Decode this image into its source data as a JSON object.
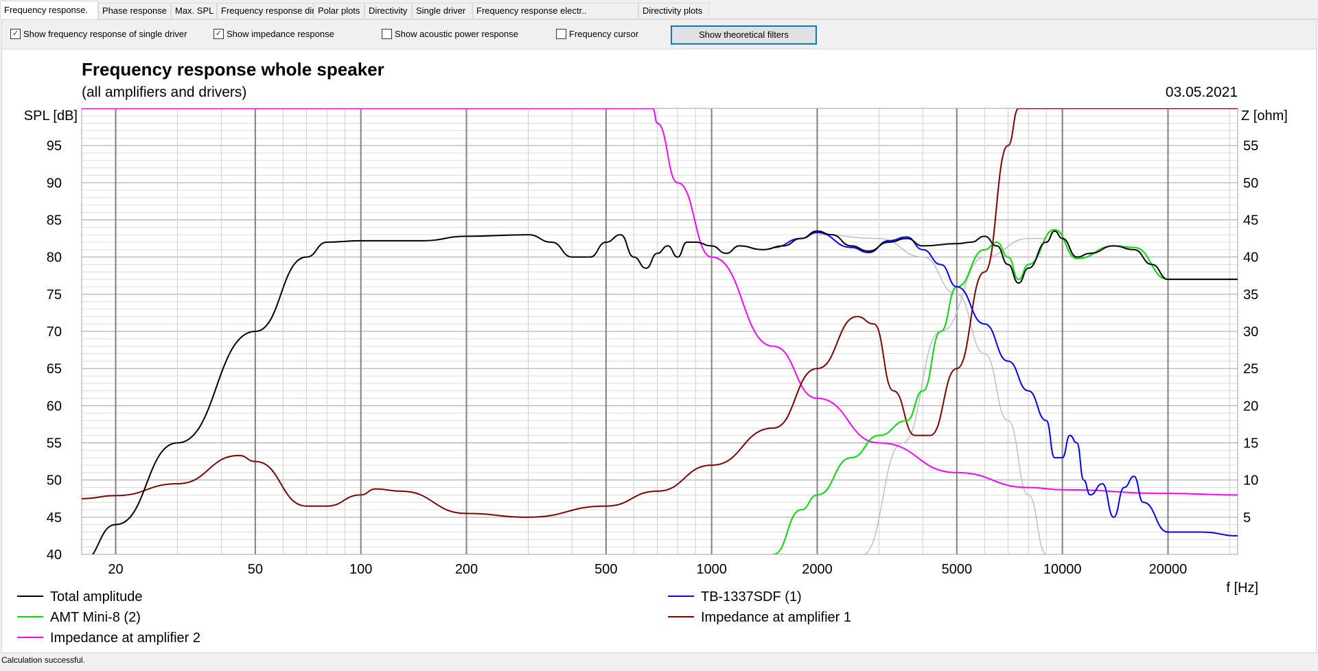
{
  "tabs": [
    "Frequency response.",
    "Phase response",
    "Max. SPL",
    "Frequency response directions",
    "Polar plots",
    "Directivity",
    "Single driver",
    "Frequency response electr..",
    "Directivity plots"
  ],
  "toolbar": {
    "checkboxes": [
      {
        "label": "Show frequency response of single driver",
        "checked": true
      },
      {
        "label": "Show impedance response",
        "checked": true
      },
      {
        "label": "Show acoustic power response",
        "checked": false
      },
      {
        "label": "Frequency cursor",
        "checked": false
      }
    ],
    "button": "Show theoretical filters"
  },
  "chart": {
    "title": "Frequency response whole speaker",
    "subtitle": "(all amplifiers and drivers)",
    "date": "03.05.2021"
  },
  "status": "Calculation successful.",
  "chart_data": {
    "type": "line",
    "xlabel": "f [Hz]",
    "ylabel": "SPL [dB]",
    "y2label": "Z [ohm]",
    "xscale": "log",
    "xlim": [
      16,
      31600
    ],
    "ylim": [
      40,
      100
    ],
    "y2lim": [
      0,
      60
    ],
    "xticks": [
      20,
      50,
      100,
      200,
      500,
      1000,
      2000,
      5000,
      10000,
      20000
    ],
    "yticks": [
      40,
      45,
      50,
      55,
      60,
      65,
      70,
      75,
      80,
      85,
      90,
      95
    ],
    "y2ticks": [
      5,
      10,
      15,
      20,
      25,
      30,
      35,
      40,
      45,
      50,
      55
    ],
    "grid": true,
    "series": [
      {
        "name": "Total amplitude",
        "color": "#000000",
        "axis": "y",
        "legend": true,
        "points": [
          [
            16,
            39
          ],
          [
            20,
            44
          ],
          [
            30,
            55
          ],
          [
            50,
            70
          ],
          [
            70,
            80
          ],
          [
            80,
            82
          ],
          [
            100,
            82.2
          ],
          [
            150,
            82.2
          ],
          [
            200,
            82.8
          ],
          [
            300,
            83
          ],
          [
            350,
            82
          ],
          [
            400,
            80
          ],
          [
            450,
            80
          ],
          [
            500,
            82
          ],
          [
            550,
            83
          ],
          [
            600,
            80
          ],
          [
            650,
            78.5
          ],
          [
            700,
            80.5
          ],
          [
            750,
            81.5
          ],
          [
            800,
            80
          ],
          [
            850,
            82
          ],
          [
            900,
            82
          ],
          [
            1000,
            81.5
          ],
          [
            1100,
            80.5
          ],
          [
            1200,
            81.5
          ],
          [
            1400,
            81
          ],
          [
            1600,
            81.5
          ],
          [
            1800,
            82.5
          ],
          [
            2000,
            83.5
          ],
          [
            2200,
            83
          ],
          [
            2500,
            81.5
          ],
          [
            2800,
            80.8
          ],
          [
            3200,
            82
          ],
          [
            3600,
            82.5
          ],
          [
            4000,
            81.5
          ],
          [
            5000,
            81.8
          ],
          [
            5500,
            82
          ],
          [
            6000,
            82.8
          ],
          [
            6500,
            81.5
          ],
          [
            7000,
            79
          ],
          [
            7500,
            76.5
          ],
          [
            8000,
            78.5
          ],
          [
            9000,
            82
          ],
          [
            9500,
            83.5
          ],
          [
            10000,
            82.5
          ],
          [
            11000,
            80
          ],
          [
            12000,
            80.5
          ],
          [
            14000,
            81.5
          ],
          [
            16000,
            81
          ],
          [
            18000,
            79
          ],
          [
            20000,
            77
          ],
          [
            25000,
            77
          ],
          [
            31600,
            77
          ]
        ]
      },
      {
        "name": "TB-1337SDF (1)",
        "color": "#0000ff",
        "axis": "y",
        "legend": true,
        "points": [
          [
            1500,
            81.3
          ],
          [
            1800,
            82.5
          ],
          [
            2000,
            83.3
          ],
          [
            2500,
            81.3
          ],
          [
            2800,
            80.6
          ],
          [
            3200,
            82.2
          ],
          [
            3600,
            82.7
          ],
          [
            4000,
            81
          ],
          [
            4500,
            79
          ],
          [
            5000,
            76
          ],
          [
            6000,
            71
          ],
          [
            7000,
            66
          ],
          [
            8000,
            62
          ],
          [
            9000,
            58
          ],
          [
            9500,
            53
          ],
          [
            10000,
            53
          ],
          [
            10500,
            56
          ],
          [
            11000,
            55
          ],
          [
            11500,
            50
          ],
          [
            12000,
            48
          ],
          [
            13000,
            49.5
          ],
          [
            14000,
            45
          ],
          [
            15000,
            49
          ],
          [
            16000,
            50.5
          ],
          [
            17000,
            47
          ],
          [
            20000,
            43
          ],
          [
            25000,
            43
          ],
          [
            31600,
            42.5
          ]
        ]
      },
      {
        "name": "AMT Mini-8 (2)",
        "color": "#00dd00",
        "axis": "y",
        "legend": true,
        "points": [
          [
            1500,
            40
          ],
          [
            1800,
            46
          ],
          [
            2000,
            48
          ],
          [
            2500,
            53
          ],
          [
            3000,
            56
          ],
          [
            3600,
            58
          ],
          [
            4000,
            62
          ],
          [
            4500,
            70
          ],
          [
            5000,
            76
          ],
          [
            6000,
            81
          ],
          [
            6500,
            82
          ],
          [
            7000,
            80
          ],
          [
            7500,
            77
          ],
          [
            8000,
            79
          ],
          [
            9500,
            83.7
          ],
          [
            11000,
            79.8
          ],
          [
            14000,
            81.5
          ],
          [
            16000,
            81.3
          ],
          [
            20000,
            77
          ],
          [
            31600,
            77
          ]
        ]
      },
      {
        "name": "Impedance at amplifier 1",
        "color": "#800000",
        "axis": "y2",
        "legend": true,
        "points": [
          [
            16,
            7.5
          ],
          [
            20,
            7.9
          ],
          [
            30,
            9.5
          ],
          [
            45,
            13.3
          ],
          [
            50,
            12.5
          ],
          [
            70,
            6.5
          ],
          [
            80,
            6.5
          ],
          [
            100,
            8
          ],
          [
            110,
            8.8
          ],
          [
            130,
            8.5
          ],
          [
            200,
            5.5
          ],
          [
            300,
            5
          ],
          [
            500,
            6.5
          ],
          [
            700,
            8.5
          ],
          [
            1000,
            12
          ],
          [
            1500,
            17
          ],
          [
            2000,
            25
          ],
          [
            2600,
            32
          ],
          [
            2900,
            31
          ],
          [
            3300,
            22
          ],
          [
            3800,
            16
          ],
          [
            4200,
            16
          ],
          [
            5000,
            25
          ],
          [
            6000,
            38
          ],
          [
            7000,
            55
          ],
          [
            7500,
            60
          ],
          [
            31600,
            60
          ]
        ]
      },
      {
        "name": "Impedance at amplifier 2",
        "color": "#ff00ff",
        "axis": "y2",
        "legend": true,
        "points": [
          [
            16,
            60
          ],
          [
            680,
            60
          ],
          [
            700,
            58
          ],
          [
            800,
            50
          ],
          [
            1000,
            40
          ],
          [
            1500,
            28
          ],
          [
            2000,
            21
          ],
          [
            3000,
            15
          ],
          [
            5000,
            11
          ],
          [
            8000,
            9
          ],
          [
            10000,
            8.7
          ],
          [
            20000,
            8.2
          ],
          [
            31600,
            8
          ]
        ]
      },
      {
        "name": "Highpass filter",
        "color": "#c0c0c0",
        "axis": "y",
        "legend": false,
        "points": [
          [
            2700,
            40
          ],
          [
            3500,
            55
          ],
          [
            4500,
            70
          ],
          [
            6000,
            80
          ],
          [
            8000,
            82.5
          ],
          [
            9000,
            82.5
          ]
        ]
      },
      {
        "name": "Lowpass filter",
        "color": "#c0c0c0",
        "axis": "y",
        "legend": false,
        "points": [
          [
            2000,
            83
          ],
          [
            3000,
            82.5
          ],
          [
            4000,
            80
          ],
          [
            5000,
            75
          ],
          [
            6000,
            67
          ],
          [
            7000,
            58
          ],
          [
            8000,
            48
          ],
          [
            9000,
            40
          ]
        ]
      }
    ]
  }
}
